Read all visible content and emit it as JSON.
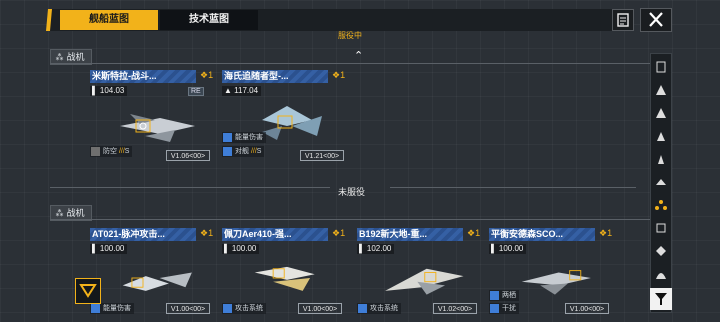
{
  "tabs": [
    {
      "label": "舰船蓝图",
      "active": true
    },
    {
      "label": "技术蓝图",
      "active": false
    }
  ],
  "partial_header": "服役中",
  "sections": {
    "top": {
      "label": "战机"
    },
    "bottom": {
      "label": "战机"
    }
  },
  "divider": {
    "label": "未服役"
  },
  "in_service": [
    {
      "title": "米斯特拉-战斗...",
      "badge": "1",
      "power": "104.03",
      "extra": "RE",
      "tags": [
        "防空"
      ],
      "rating": "S",
      "version": "V1.06<00>"
    },
    {
      "title": "海氏追随者型-...",
      "badge": "1",
      "power": "117.04",
      "tags": [
        "能量伤害",
        "对舰"
      ],
      "rating": "S",
      "version": "V1.21<00>"
    }
  ],
  "not_in_service": [
    {
      "title": "AT021-脉冲攻击...",
      "badge": "1",
      "power": "100.00",
      "tags": [
        "能量伤害"
      ],
      "version": "V1.00<00>"
    },
    {
      "title": "佩刀Aer410-强...",
      "badge": "1",
      "power": "100.00",
      "tags": [
        "攻击系统"
      ],
      "version": "V1.00<00>"
    },
    {
      "title": "B192新大地-重...",
      "badge": "1",
      "power": "102.00",
      "tags": [
        "攻击系统"
      ],
      "version": "V1.02<00>"
    },
    {
      "title": "平衡安德森SCO...",
      "badge": "1",
      "power": "100.00",
      "tags": [
        "两栖",
        "干扰"
      ],
      "version": "V1.00<00>"
    }
  ],
  "colors": {
    "accent": "#f2b21a",
    "title_bar": "#2f5a9c"
  }
}
